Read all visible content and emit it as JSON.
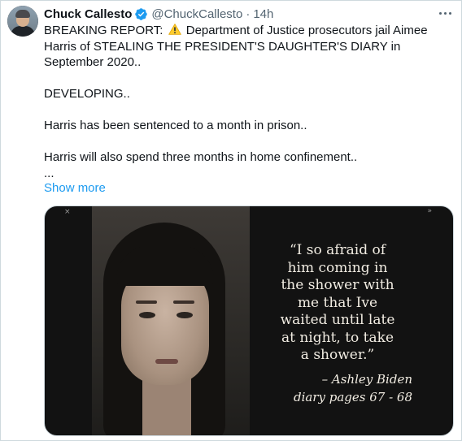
{
  "tweet": {
    "author_name": "Chuck Callesto",
    "handle": "@ChuckCallesto",
    "separator": "·",
    "time": "14h",
    "text_line1_before": "BREAKING REPORT: ",
    "text_line1_after": " Department of Justice prosecutors jail Aimee Harris of STEALING THE PRESIDENT'S DAUGHTER'S DIARY in September 2020..",
    "paragraph_developing": "DEVELOPING..",
    "paragraph_sentence": "Harris has been sentenced to a month in prison..",
    "paragraph_home": "Harris will also spend three months in home confinement..",
    "ellipsis": "...",
    "show_more": "Show more",
    "icons": {
      "verified": "verified-badge-icon",
      "warning": "warning-emoji-icon",
      "more": "more-options-icon"
    },
    "colors": {
      "link": "#1d9bf0",
      "verified": "#1d9bf0",
      "secondary_text": "#536471"
    }
  },
  "media": {
    "quote_lines": [
      "“I so afraid of",
      "him coming in",
      "the shower with",
      "me that Ive",
      "waited until late",
      "at night, to take",
      "a shower.”"
    ],
    "attribution": "– Ashley Biden",
    "source": "diary pages 67 - 68",
    "control_left": "×",
    "control_right": "»"
  }
}
